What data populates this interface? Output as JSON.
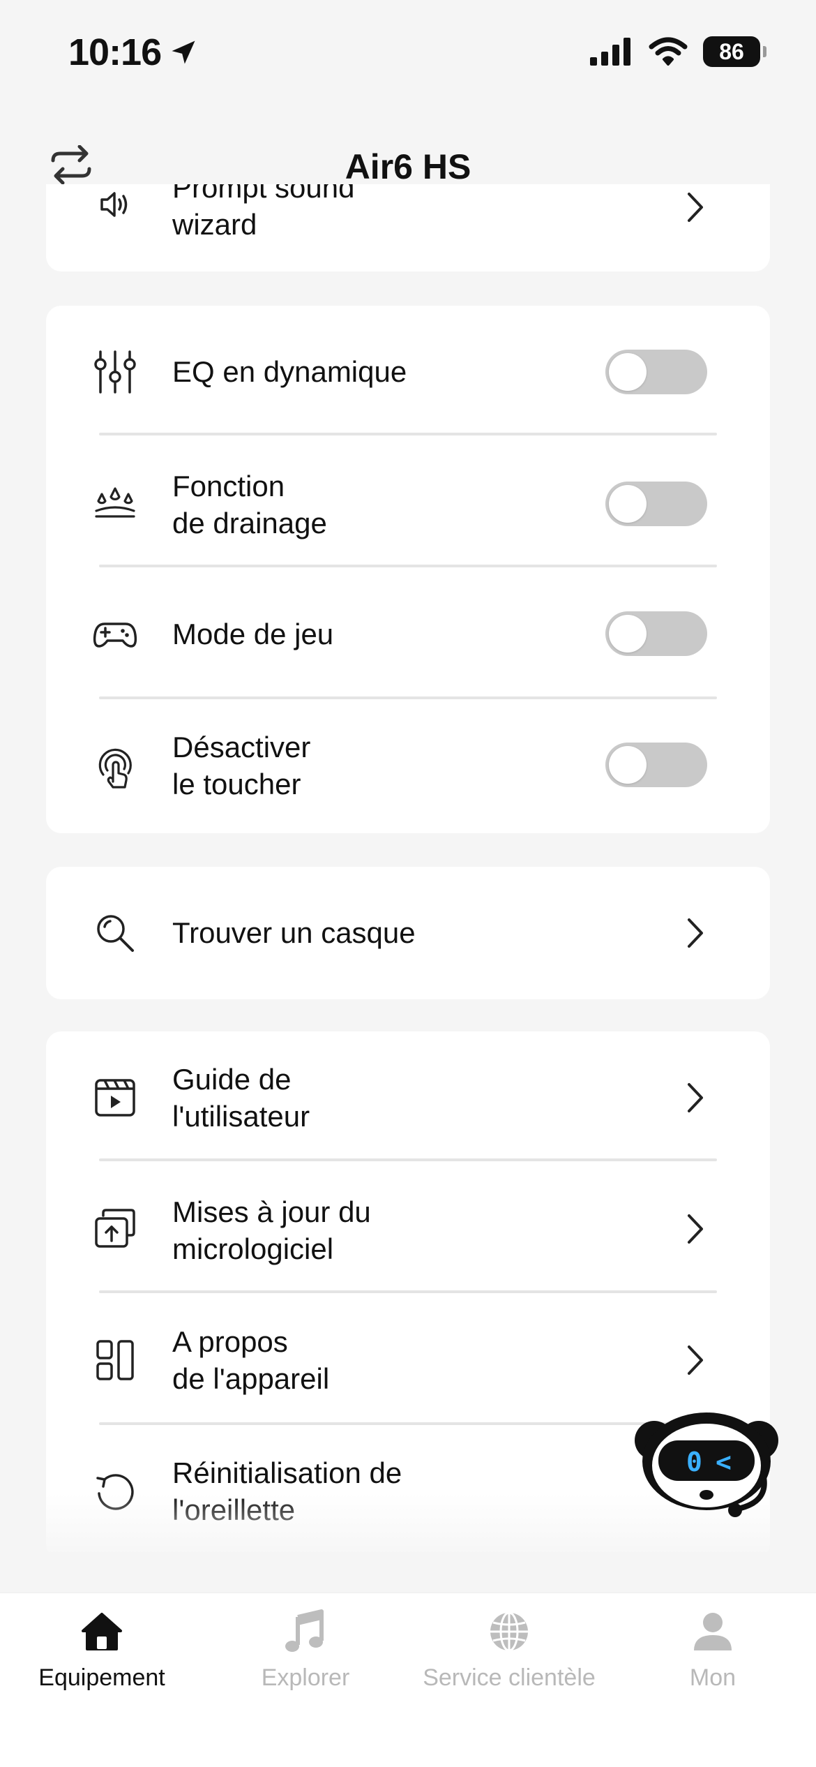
{
  "status_bar": {
    "time": "10:16",
    "battery": "86"
  },
  "header": {
    "title": "Air6 HS"
  },
  "cards": {
    "top": {
      "label": "Prompt sound\nwizard"
    },
    "toggles": [
      {
        "label": "EQ en dynamique",
        "on": false
      },
      {
        "label": "Fonction\nde drainage",
        "on": false
      },
      {
        "label": "Mode de jeu",
        "on": false
      },
      {
        "label": "Désactiver\nle toucher",
        "on": false
      }
    ],
    "find": {
      "label": "Trouver un casque"
    },
    "info": [
      {
        "label": "Guide de\nl'utilisateur"
      },
      {
        "label": "Mises à jour du\nmicrologiciel"
      },
      {
        "label": "A propos\nde l'appareil"
      },
      {
        "label": "Réinitialisation de\nl'oreillette"
      }
    ]
  },
  "tabbar": {
    "tabs": [
      {
        "label": "Equipement",
        "icon": "home-icon",
        "active": true
      },
      {
        "label": "Explorer",
        "icon": "music-note-icon",
        "active": false
      },
      {
        "label": "Service clientèle",
        "icon": "globe-icon",
        "active": false
      },
      {
        "label": "Mon",
        "icon": "person-icon",
        "active": false
      }
    ]
  },
  "colors": {
    "background": "#f5f5f5",
    "card": "#ffffff",
    "toggle_off": "#c9c9c9",
    "active_tab": "#111111",
    "inactive_tab": "#b8b8b8",
    "mascot_eye": "#3ab0ff"
  }
}
